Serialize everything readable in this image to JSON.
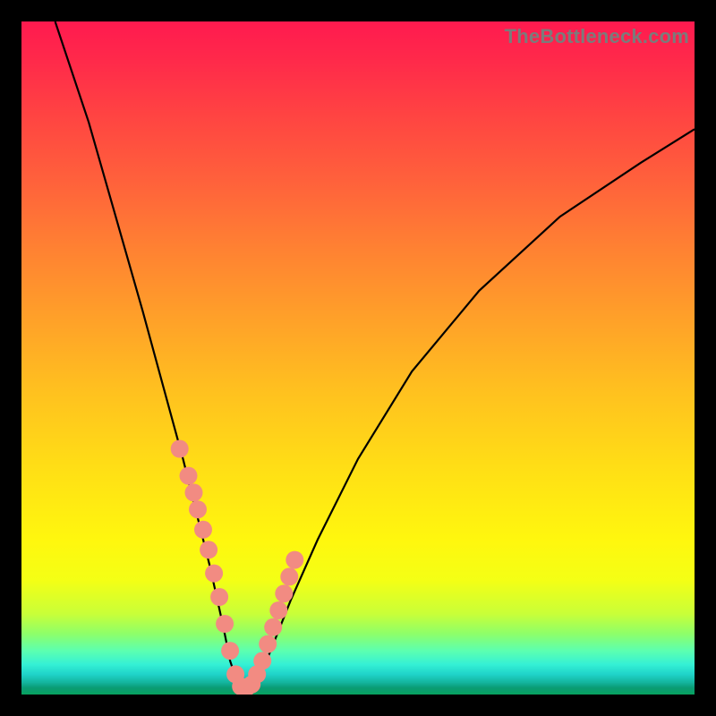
{
  "watermark": "TheBottleneck.com",
  "chart_data": {
    "type": "line",
    "title": "",
    "xlabel": "",
    "ylabel": "",
    "xlim": [
      0,
      100
    ],
    "ylim": [
      0,
      100
    ],
    "grid": false,
    "legend": false,
    "note": "Axes are normalized 0–100; values read from pixel positions of the curve relative to the gradient area. The V-shaped curve reaches its minimum (≈0) near x≈33.",
    "series": [
      {
        "name": "bottleneck-curve",
        "x": [
          5,
          10,
          14,
          18,
          21,
          24,
          26,
          28,
          30,
          31,
          32,
          33,
          34,
          35,
          36,
          38,
          40,
          44,
          50,
          58,
          68,
          80,
          92,
          100
        ],
        "values": [
          100,
          85,
          71,
          57,
          46,
          35,
          27,
          19,
          10,
          5,
          2,
          1,
          1,
          2,
          4,
          9,
          14,
          23,
          35,
          48,
          60,
          71,
          79,
          84
        ]
      }
    ],
    "markers": {
      "name": "highlighted-points",
      "color": "#f28b82",
      "points_x": [
        23.5,
        24.8,
        25.6,
        26.2,
        27.0,
        27.8,
        28.6,
        29.4,
        30.2,
        31.0,
        31.8,
        32.6,
        33.4,
        34.2,
        35.0,
        35.8,
        36.6,
        37.4,
        38.2,
        39.0,
        39.8,
        40.6
      ],
      "points_values": [
        36.5,
        32.5,
        30.0,
        27.5,
        24.5,
        21.5,
        18.0,
        14.5,
        10.5,
        6.5,
        3.0,
        1.2,
        1.0,
        1.5,
        3.0,
        5.0,
        7.5,
        10.0,
        12.5,
        15.0,
        17.5,
        20.0
      ]
    },
    "background_gradient_stops": [
      {
        "pos": 0,
        "color": "#ff1a4f"
      },
      {
        "pos": 0.5,
        "color": "#ffb024"
      },
      {
        "pos": 0.8,
        "color": "#fff70e"
      },
      {
        "pos": 0.93,
        "color": "#5cffb0"
      },
      {
        "pos": 1.0,
        "color": "#07a35f"
      }
    ]
  }
}
